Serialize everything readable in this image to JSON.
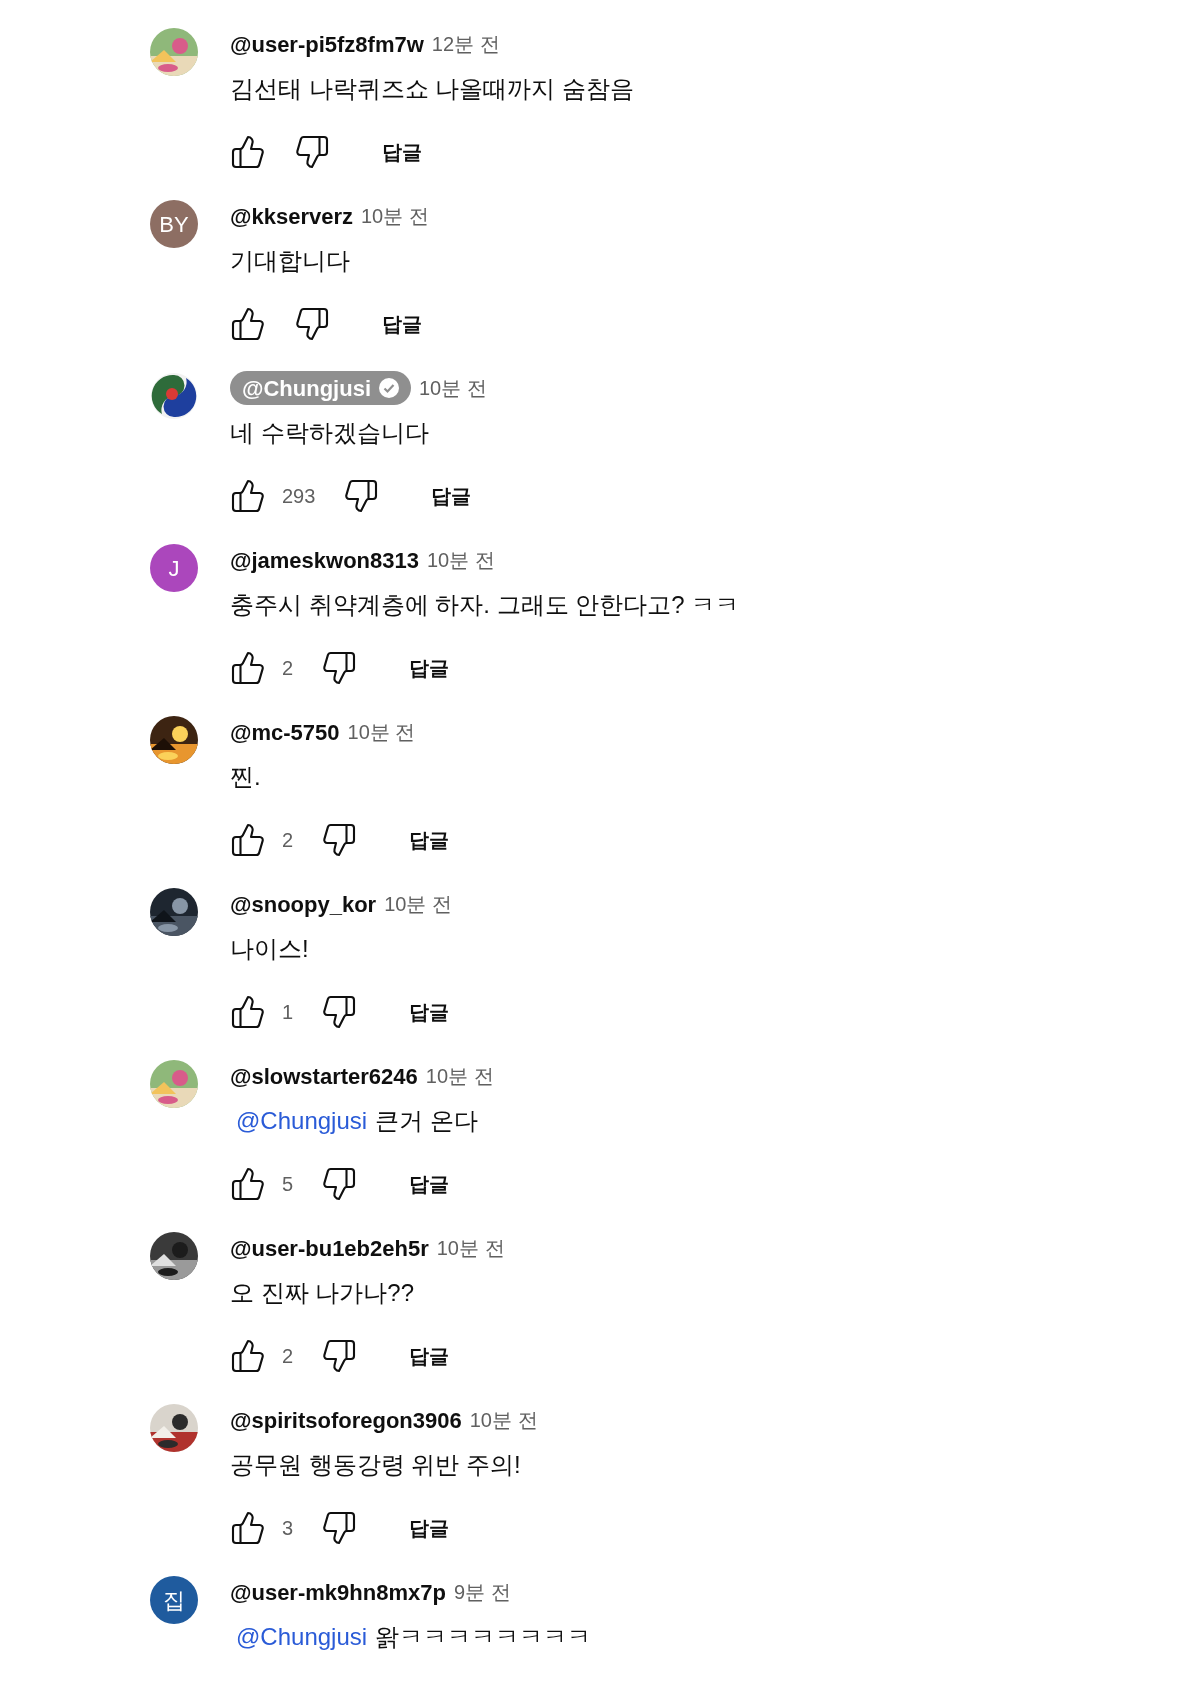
{
  "comments": [
    {
      "author": "@user-pi5fz8fm7w",
      "creator": false,
      "time": "12분 전",
      "text": "김선태 나락퀴즈쇼 나올때까지 숨참음",
      "reply": "답글"
    },
    {
      "avatar": {
        "kind": "letter",
        "letter": "BY",
        "color": "#8d6e63"
      },
      "author": "@kkserverz",
      "creator": false,
      "time": "10분 전",
      "text": "기대합니다",
      "reply": "답글"
    },
    {
      "avatar": {
        "kind": "logo"
      },
      "author": "@Chungjusi",
      "creator": true,
      "time": "10분 전",
      "text": "네 수락하겠습니다",
      "likes": "293",
      "reply": "답글"
    },
    {
      "avatar": {
        "kind": "letter",
        "letter": "J",
        "color": "#ab47bc"
      },
      "author": "@jameskwon8313",
      "creator": false,
      "time": "10분 전",
      "text": "충주시 취약계층에 하자. 그래도 안한다고? ㅋㅋ",
      "likes": "2",
      "reply": "답글"
    },
    {
      "author": "@mc-5750",
      "creator": false,
      "time": "10분 전",
      "text": "찐.",
      "likes": "2",
      "reply": "답글"
    },
    {
      "author": "@snoopy_kor",
      "creator": false,
      "time": "10분 전",
      "text": "나이스!",
      "likes": "1",
      "reply": "답글"
    },
    {
      "author": "@slowstarter6246",
      "creator": false,
      "time": "10분 전",
      "mention": "@Chungjusi",
      "text": "큰거 온다",
      "likes": "5",
      "reply": "답글"
    },
    {
      "author": "@user-bu1eb2eh5r",
      "creator": false,
      "time": "10분 전",
      "text": "오 진짜 나가나??",
      "likes": "2",
      "reply": "답글"
    },
    {
      "author": "@spiritsoforegon3906",
      "creator": false,
      "time": "10분 전",
      "text": "공무원 행동강령 위반 주의!",
      "likes": "3",
      "reply": "답글"
    },
    {
      "avatar": {
        "kind": "letter",
        "letter": "집",
        "color": "#1f5b9e"
      },
      "author": "@user-mk9hn8mx7p",
      "creator": false,
      "time": "9분 전",
      "mention": "@Chungjusi",
      "text": "왉ㅋㅋㅋㅋㅋㅋㅋㅋ"
    }
  ]
}
